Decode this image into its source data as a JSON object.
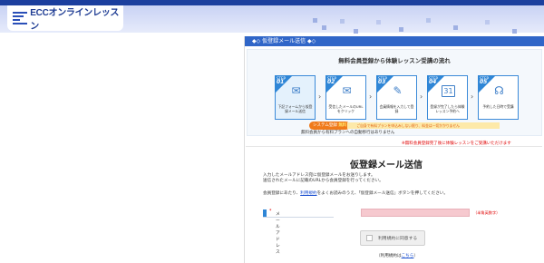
{
  "header": {
    "logo_text": "ECCオンラインレッスン"
  },
  "panel": {
    "heading": "◆◇ 仮登録メール送信 ◆◇",
    "flow_title": "無料会員登録から体験レッスン受講の流れ",
    "steps": [
      {
        "step_word": "STEP",
        "num": "01",
        "icon": "mail-icon",
        "label": "下記フォームから仮登録メール送信"
      },
      {
        "step_word": "STEP",
        "num": "02",
        "icon": "mail-link-icon",
        "label": "受信したメールのURLをクリック"
      },
      {
        "step_word": "STEP",
        "num": "03",
        "icon": "pencil-icon",
        "label": "会員情報を入力して登録"
      },
      {
        "step_word": "STEP",
        "num": "04",
        "icon": "calendar-icon",
        "label": "登録が完了したら体験レッスン予約へ"
      },
      {
        "step_word": "STEP",
        "num": "05",
        "icon": "headset-icon",
        "label": "予約した日時で受講"
      }
    ],
    "system_badge_label": "システム登録",
    "system_badge_free": "無料",
    "system_bar_text": "ご自身で有料プランを申込みしない限り、料金は一切かかりません",
    "note_auto": "無料会員から有料プランへの自動移行はありません",
    "note_red": "※無料会員登録完了後に体験レッスンをご受講いただけます"
  },
  "form": {
    "title": "仮登録メール送信",
    "intro_line1": "入力したメールアドレス宛に仮登録メールをお送りします。",
    "intro_line2": "送信されたメールに記載のURLから会員登録を行ってください。",
    "consent_prefix": "会員登録にあたり、",
    "consent_link": "利用規約",
    "consent_suffix": "をよくお読みのうえ、「仮登録メール送信」ボタンを押してください。",
    "email_label": "メールアドレス",
    "email_required_mark": "*",
    "email_note": "（半角英数字）",
    "email_value": "",
    "agree_button": "利用規約に同意する",
    "terms_prefix": "（利用規約は",
    "terms_link": "こちら",
    "terms_suffix": "）"
  },
  "colors": {
    "accent_blue": "#2f86d6",
    "topbar_navy": "#1c3f9e",
    "input_pink": "#f6c9cf",
    "alert_red": "#e00000"
  }
}
